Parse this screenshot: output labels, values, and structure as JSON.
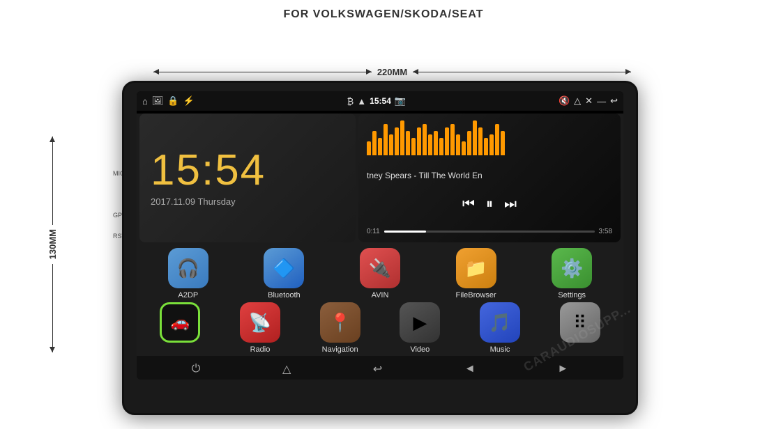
{
  "page": {
    "title": "FOR VOLKSWAGEN/SKODA/SEAT"
  },
  "dimensions": {
    "width_label": "220MM",
    "height_label": "130MM"
  },
  "side_labels": {
    "mic": "MIC",
    "gps": "GPS",
    "rst": "RST"
  },
  "status_bar": {
    "time": "15:54",
    "icons": [
      "home",
      "image",
      "lock",
      "usb",
      "bluetooth",
      "wifi",
      "camera",
      "volume",
      "eject",
      "close",
      "back"
    ]
  },
  "clock_widget": {
    "time": "15:54",
    "date": "2017.11.09 Thursday"
  },
  "music_widget": {
    "title": "tney Spears - Till The World En",
    "time_elapsed": "0:11",
    "time_total": "3:58",
    "bars": [
      4,
      7,
      5,
      9,
      6,
      8,
      10,
      7,
      5,
      8,
      9,
      6,
      7,
      5,
      8,
      9,
      6,
      4,
      7,
      10,
      8,
      5,
      6,
      9,
      7
    ]
  },
  "apps_row1": [
    {
      "id": "a2dp",
      "label": "A2DP",
      "icon": "🎧",
      "color": "app-a2dp"
    },
    {
      "id": "bluetooth",
      "label": "Bluetooth",
      "icon": "🔷",
      "color": "app-bluetooth"
    },
    {
      "id": "avin",
      "label": "AVIN",
      "icon": "🔌",
      "color": "app-avin"
    },
    {
      "id": "filebrowser",
      "label": "FileBrowser",
      "icon": "📁",
      "color": "app-filebrowser"
    },
    {
      "id": "settings",
      "label": "Settings",
      "icon": "⚙️",
      "color": "app-settings"
    }
  ],
  "apps_row2": [
    {
      "id": "car",
      "label": "",
      "icon": "🚗",
      "color": "app-car"
    },
    {
      "id": "radio",
      "label": "Radio",
      "icon": "📡",
      "color": "app-radio"
    },
    {
      "id": "navigation",
      "label": "Navigation",
      "icon": "📍",
      "color": "app-navigation"
    },
    {
      "id": "video",
      "label": "Video",
      "icon": "▶",
      "color": "app-video"
    },
    {
      "id": "music",
      "label": "Music",
      "icon": "🎵",
      "color": "app-music"
    },
    {
      "id": "more",
      "label": "",
      "icon": "⠿",
      "color": "app-more"
    }
  ],
  "bottom_nav": {
    "buttons": [
      "⏻",
      "△",
      "↩",
      "◄",
      "►"
    ]
  }
}
